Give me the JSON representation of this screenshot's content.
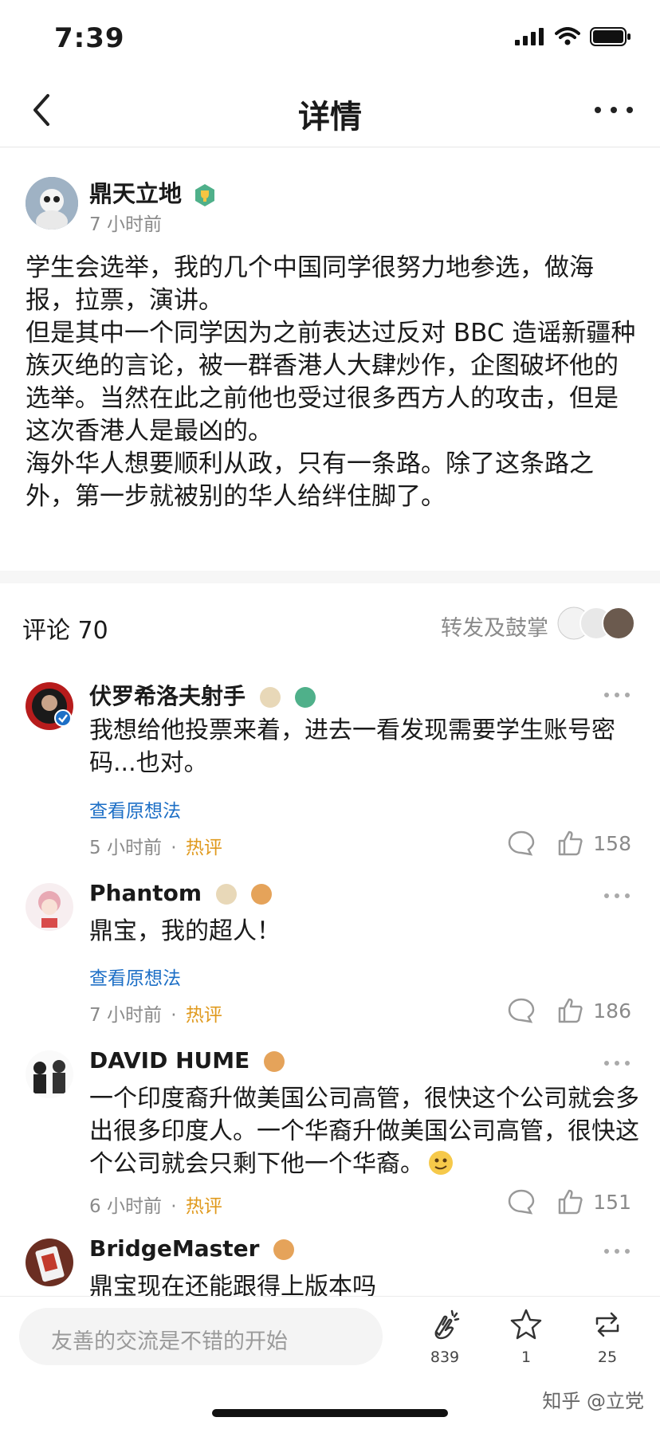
{
  "status": {
    "time": "7:39"
  },
  "nav": {
    "title": "详情"
  },
  "post": {
    "author": "鼎天立地",
    "time": "7 小时前",
    "paragraphs": [
      "学生会选举，我的几个中国同学很努力地参选，做海报，拉票，演讲。",
      "但是其中一个同学因为之前表达过反对 BBC 造谣新疆种族灭绝的言论，被一群香港人大肆炒作，企图破坏他的选举。当然在此之前他也受过很多西方人的攻击，但是这次香港人是最凶的。",
      "海外华人想要顺利从政，只有一条路。除了这条路之外，第一步就被别的华人给绊住脚了。"
    ]
  },
  "comments_header": {
    "title": "评论 70",
    "reposts_label": "转发及鼓掌"
  },
  "comments": [
    {
      "name": "伏罗希洛夫射手",
      "text": "我想给他投票来着，进去一看发现需要学生账号密码...也对。",
      "link": "查看原想法",
      "time": "5 小时前",
      "hot": "热评",
      "likes": "158"
    },
    {
      "name": "Phantom",
      "text": "鼎宝，我的超人！",
      "link": "查看原想法",
      "time": "7 小时前",
      "hot": "热评",
      "likes": "186"
    },
    {
      "name": "DAVID HUME",
      "text": "一个印度裔升做美国公司高管，很快这个公司就会多出很多印度人。一个华裔升做美国公司高管，很快这个公司就会只剩下他一个华裔。",
      "link": "",
      "time": "6 小时前",
      "hot": "热评",
      "likes": "151"
    },
    {
      "name": "BridgeMaster",
      "text": "鼎宝现在还能跟得上版本吗",
      "link": "",
      "time": "",
      "hot": "",
      "likes": ""
    }
  ],
  "separator": "·",
  "bottom_bar": {
    "input_placeholder": "友善的交流是不错的开始",
    "clap_count": "839",
    "star_count": "1",
    "repost_count": "25"
  },
  "watermark": "知乎 @立党",
  "colors": {
    "link": "#1d6fc6",
    "hot": "#e09a1e",
    "meta": "#8a8a8a"
  }
}
